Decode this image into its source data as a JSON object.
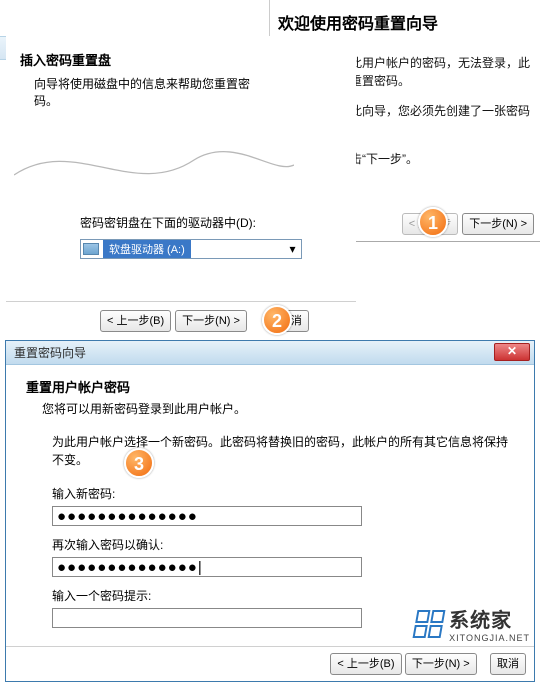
{
  "welcome": {
    "title": "欢迎使用密码重置向导",
    "p1": "如果您忘记了此用户帐户的密码，无法登录，此向导将帮助您重置密码。",
    "p2": "注意：要使用此向导，您必须先创建了一张密码重置盘。",
    "p3": "要继续，请单击“下一步”。",
    "back": "< 上一步",
    "next": "下一步(N) >"
  },
  "disk": {
    "titlebar": "重置密码向导",
    "heading": "插入密码重置盘",
    "sub": "向导将使用磁盘中的信息来帮助您重置密码。",
    "drive_label": "密码密钥盘在下面的驱动器中(D):",
    "drive_value": "软盘驱动器 (A:)",
    "back": "< 上一步(B)",
    "next": "下一步(N) >",
    "cancel": "取消"
  },
  "reset": {
    "titlebar": "重置密码向导",
    "heading": "重置用户帐户密码",
    "sub": "您将可以用新密码登录到此用户帐户。",
    "desc": "为此用户帐户选择一个新密码。此密码将替换旧的密码，此帐户的所有其它信息将保持不变。",
    "new_pw_label": "输入新密码:",
    "new_pw_value": "●●●●●●●●●●●●●●",
    "confirm_label": "再次输入密码以确认:",
    "confirm_value": "●●●●●●●●●●●●●●|",
    "hint_label": "输入一个密码提示:",
    "hint_value": "",
    "back": "< 上一步(B)",
    "next": "下一步(N) >",
    "cancel": "取消"
  },
  "badges": {
    "b1": "1",
    "b2": "2",
    "b3": "3"
  },
  "watermark": {
    "cn": "系统家",
    "en": "XITONGJIA.NET"
  },
  "icons": {
    "close": "✕",
    "chevron_down": "▾"
  }
}
